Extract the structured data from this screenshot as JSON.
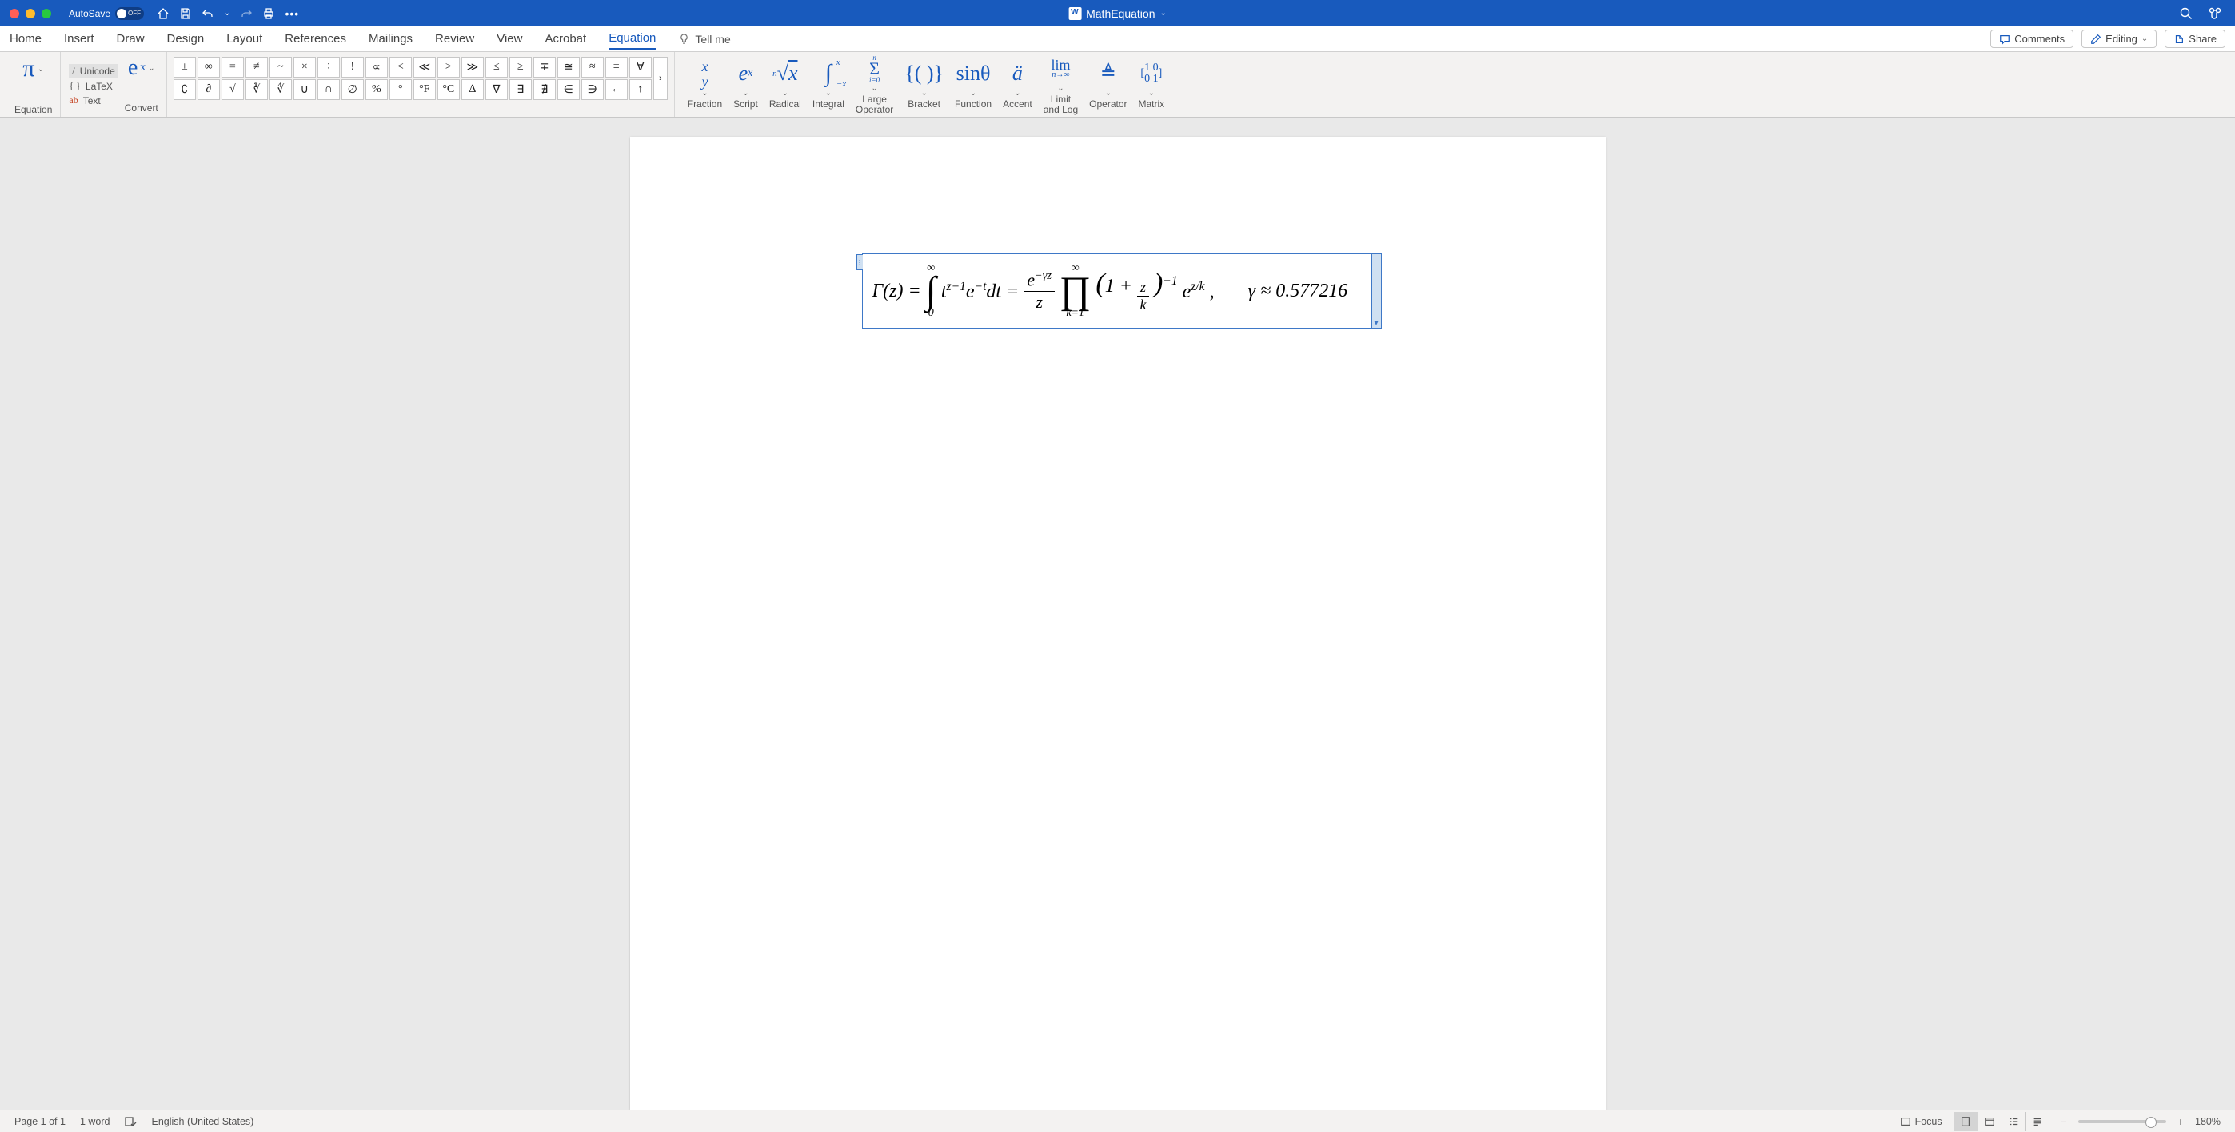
{
  "title": {
    "document_name": "MathEquation",
    "autosave_label": "AutoSave",
    "autosave_state": "OFF"
  },
  "tabs": {
    "home": "Home",
    "insert": "Insert",
    "draw": "Draw",
    "design": "Design",
    "layout": "Layout",
    "references": "References",
    "mailings": "Mailings",
    "review": "Review",
    "view": "View",
    "acrobat": "Acrobat",
    "equation": "Equation",
    "tellme": "Tell me",
    "comments": "Comments",
    "editing": "Editing",
    "share": "Share"
  },
  "ribbon": {
    "equation_group": "Equation",
    "convert": {
      "unicode": "Unicode",
      "latex": "LaTeX",
      "text": "Text",
      "label": "Convert"
    },
    "symbols_row1": [
      "±",
      "∞",
      "=",
      "≠",
      "~",
      "×",
      "÷",
      "!",
      "∝",
      "<",
      "≪",
      ">",
      "≫",
      "≤",
      "≥",
      "∓",
      "≅",
      "≈",
      "≡",
      "∀"
    ],
    "symbols_row2": [
      "∁",
      "∂",
      "√",
      "∛",
      "∜",
      "∪",
      "∩",
      "∅",
      "%",
      "°",
      "°F",
      "°C",
      "∆",
      "∇",
      "∃",
      "∄",
      "∈",
      "∋",
      "←",
      "↑"
    ],
    "struct": {
      "fraction": "Fraction",
      "script": "Script",
      "radical": "Radical",
      "integral": "Integral",
      "large_operator": "Large\nOperator",
      "bracket": "Bracket",
      "function": "Function",
      "accent": "Accent",
      "limit": "Limit\nand Log",
      "operator": "Operator",
      "matrix": "Matrix"
    }
  },
  "equation": {
    "expr_plain": "Γ(z) = ∫₀^∞ t^{z−1} e^{−t} dt = (e^{−γz}/z) ∏_{k=1}^{∞} (1 + z/k)^{−1} e^{z/k},   γ ≈ 0.577216",
    "gamma_lhs": "Γ(z) =",
    "int_lower": "0",
    "int_upper": "∞",
    "integrand": "t",
    "integrand_exp": "z−1",
    "e_neg_t": "e",
    "e_neg_t_exp": "−t",
    "dt": "dt =",
    "frac_top_base": "e",
    "frac_top_exp": "−γz",
    "frac_bot": "z",
    "prod_lower": "k=1",
    "prod_upper": "∞",
    "paren_l": "(",
    "one_plus": "1 +",
    "inner_frac_top": "z",
    "inner_frac_bot": "k",
    "paren_r": ")",
    "paren_exp": "−1",
    "e_zk_base": "e",
    "e_zk_exp": "z/k",
    "comma": ",",
    "gamma_approx": "γ ≈ 0.577216"
  },
  "status": {
    "page": "Page 1 of 1",
    "words": "1 word",
    "lang": "English (United States)",
    "focus": "Focus",
    "zoom": "180%"
  }
}
